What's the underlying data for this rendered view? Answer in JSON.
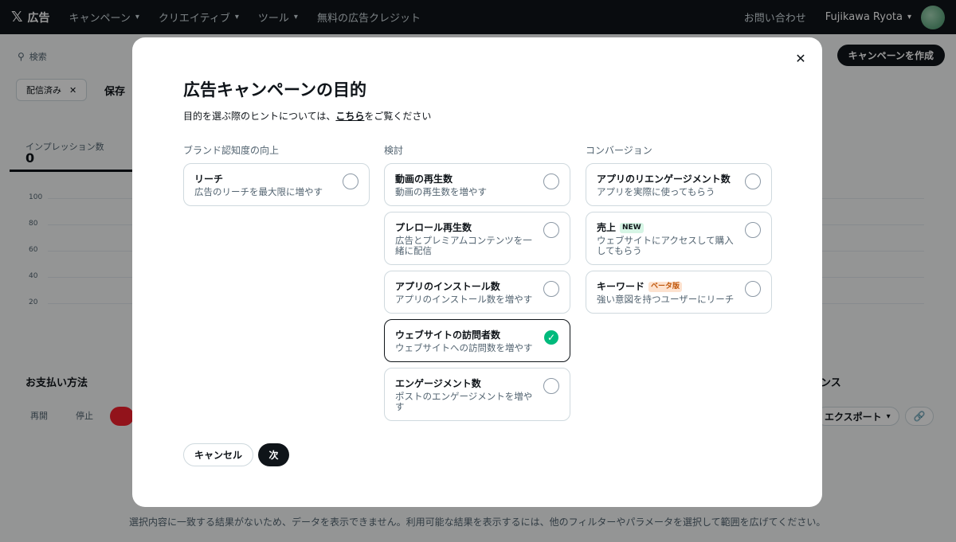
{
  "topnav": {
    "logo": "𝕏",
    "brand": "広告",
    "items": [
      {
        "label": "キャンペーン",
        "dropdown": true
      },
      {
        "label": "クリエイティブ",
        "dropdown": true
      },
      {
        "label": "ツール",
        "dropdown": true
      },
      {
        "label": "無料の広告クレジット",
        "dropdown": false
      }
    ],
    "help": "お問い合わせ",
    "user_name": "Fujikawa Ryota"
  },
  "background": {
    "search_placeholder": "検索",
    "create_button": "キャンペーンを作成",
    "filter_chip": "配信済み",
    "save_link": "保存",
    "metric_label": "インプレッション数",
    "metric_value": "0",
    "y_ticks": [
      "100",
      "80",
      "60",
      "40",
      "20"
    ],
    "payment_title": "お支払い方法",
    "actions": [
      "再開",
      "停止"
    ],
    "right_subtitle": "ンス",
    "export_button": "エクスポート",
    "empty_message": "選択内容に一致する結果がないため、データを表示できません。利用可能な結果を表示するには、他のフィルターやパラメータを選択して範囲を広げてください。"
  },
  "modal": {
    "title": "広告キャンペーンの目的",
    "hint_prefix": "目的を選ぶ際のヒントについては、",
    "hint_link": "こちら",
    "hint_suffix": "をご覧ください",
    "columns": [
      {
        "title": "ブランド認知度の向上",
        "options": [
          {
            "title": "リーチ",
            "desc": "広告のリーチを最大限に増やす",
            "selected": false,
            "badge": null
          }
        ]
      },
      {
        "title": "検討",
        "options": [
          {
            "title": "動画の再生数",
            "desc": "動画の再生数を増やす",
            "selected": false,
            "badge": null
          },
          {
            "title": "プレロール再生数",
            "desc": "広告とプレミアムコンテンツを一緒に配信",
            "selected": false,
            "badge": null
          },
          {
            "title": "アプリのインストール数",
            "desc": "アプリのインストール数を増やす",
            "selected": false,
            "badge": null
          },
          {
            "title": "ウェブサイトの訪問者数",
            "desc": "ウェブサイトへの訪問数を増やす",
            "selected": true,
            "badge": null
          },
          {
            "title": "エンゲージメント数",
            "desc": "ポストのエンゲージメントを増やす",
            "selected": false,
            "badge": null
          }
        ]
      },
      {
        "title": "コンバージョン",
        "options": [
          {
            "title": "アプリのリエンゲージメント数",
            "desc": "アプリを実際に使ってもらう",
            "selected": false,
            "badge": null
          },
          {
            "title": "売上",
            "desc": "ウェブサイトにアクセスして購入してもらう",
            "selected": false,
            "badge": {
              "text": "NEW",
              "kind": "new"
            }
          },
          {
            "title": "キーワード",
            "desc": "強い意図を持つユーザーにリーチ",
            "selected": false,
            "badge": {
              "text": "ベータ版",
              "kind": "beta"
            }
          }
        ]
      }
    ],
    "cancel_button": "キャンセル",
    "next_button": "次"
  }
}
